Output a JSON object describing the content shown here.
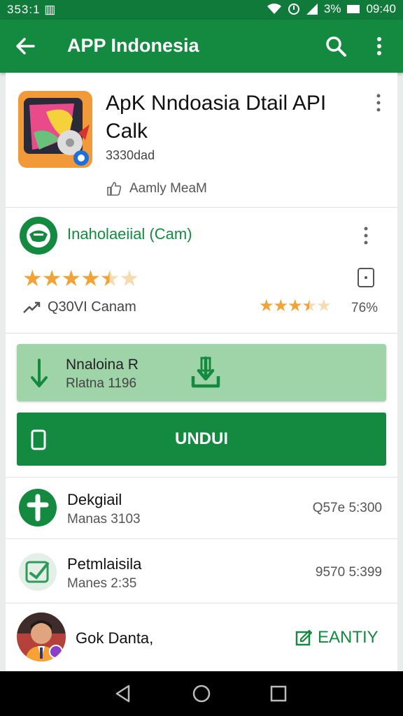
{
  "status_bar": {
    "left_text": "353:1 ▥",
    "battery": "3%",
    "time": "09:40"
  },
  "app_bar": {
    "title": "APP Indonesia"
  },
  "app": {
    "title": "ApK Nndoasia Dtail API Calk",
    "subtitle": "3330dad",
    "meta": "Aamly MeaM"
  },
  "developer": {
    "name": "Inaholaeiial (Cam)"
  },
  "rating": {
    "stars": 4.5,
    "info_text": "Q30VI Canam",
    "small_stars": 3.5,
    "percent": "76%"
  },
  "download_box": {
    "title": "Nnaloina R",
    "subtitle": "Rlatna 1196"
  },
  "install_button": {
    "label": "UNDUI"
  },
  "list": [
    {
      "title": "Dekgiail",
      "subtitle": "Manas 3103",
      "value": "Q57e 5:300"
    },
    {
      "title": "Petmlaisila",
      "subtitle": "Manes 2:35",
      "value": "9570 5:399"
    }
  ],
  "author": {
    "name": "Gok  Danta,",
    "action": "EANTIY"
  },
  "colors": {
    "primary": "#138a40",
    "status_bar": "#107a3a",
    "accent_light": "#9fd3a8",
    "star": "#f2a338"
  },
  "icons": [
    "back-arrow-icon",
    "search-icon",
    "more-vert-icon",
    "thumb-up-icon",
    "tablet-icon",
    "download-icon",
    "phone-icon",
    "home-icon",
    "back-nav-icon",
    "recents-icon",
    "edit-icon"
  ]
}
